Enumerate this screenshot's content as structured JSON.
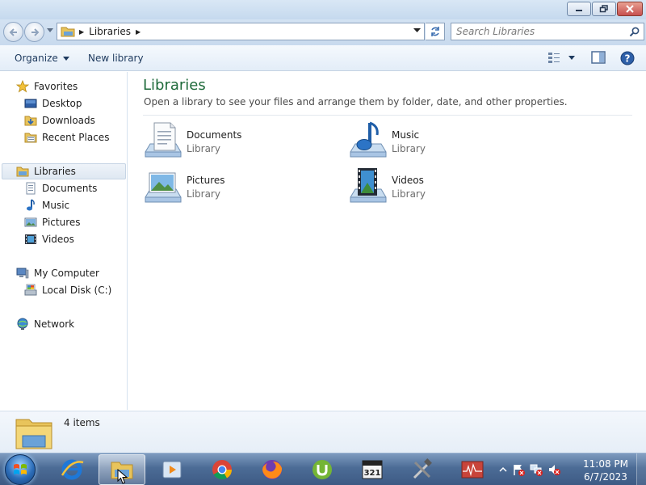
{
  "window": {
    "colors": {
      "title_green": "#1e6a3a",
      "accent": "#1e3a5e"
    }
  },
  "address": {
    "crumb": "Libraries",
    "search_placeholder": "Search Libraries"
  },
  "toolbar": {
    "organize_label": "Organize",
    "new_library_label": "New library"
  },
  "sidebar": {
    "favorites": {
      "label": "Favorites",
      "items": [
        "Desktop",
        "Downloads",
        "Recent Places"
      ]
    },
    "libraries": {
      "label": "Libraries",
      "items": [
        "Documents",
        "Music",
        "Pictures",
        "Videos"
      ]
    },
    "computer": {
      "label": "My Computer",
      "items": [
        "Local Disk (C:)"
      ]
    },
    "network": {
      "label": "Network"
    }
  },
  "content": {
    "title": "Libraries",
    "subtitle": "Open a library to see your files and arrange them by folder, date, and other properties.",
    "libraries": [
      {
        "name": "Documents",
        "type": "Library",
        "icon": "documents-library-icon"
      },
      {
        "name": "Music",
        "type": "Library",
        "icon": "music-library-icon"
      },
      {
        "name": "Pictures",
        "type": "Library",
        "icon": "pictures-library-icon"
      },
      {
        "name": "Videos",
        "type": "Library",
        "icon": "videos-library-icon"
      }
    ]
  },
  "details": {
    "count": "4 items"
  },
  "taskbar": {
    "apps": [
      "internet-explorer-icon",
      "windows-explorer-icon",
      "media-player-icon",
      "chrome-icon",
      "firefox-icon",
      "utorrent-icon",
      "media-player-classic-icon",
      "tools-icon",
      "task-manager-icon"
    ],
    "clock_time": "11:08 PM",
    "clock_date": "6/7/2023"
  }
}
